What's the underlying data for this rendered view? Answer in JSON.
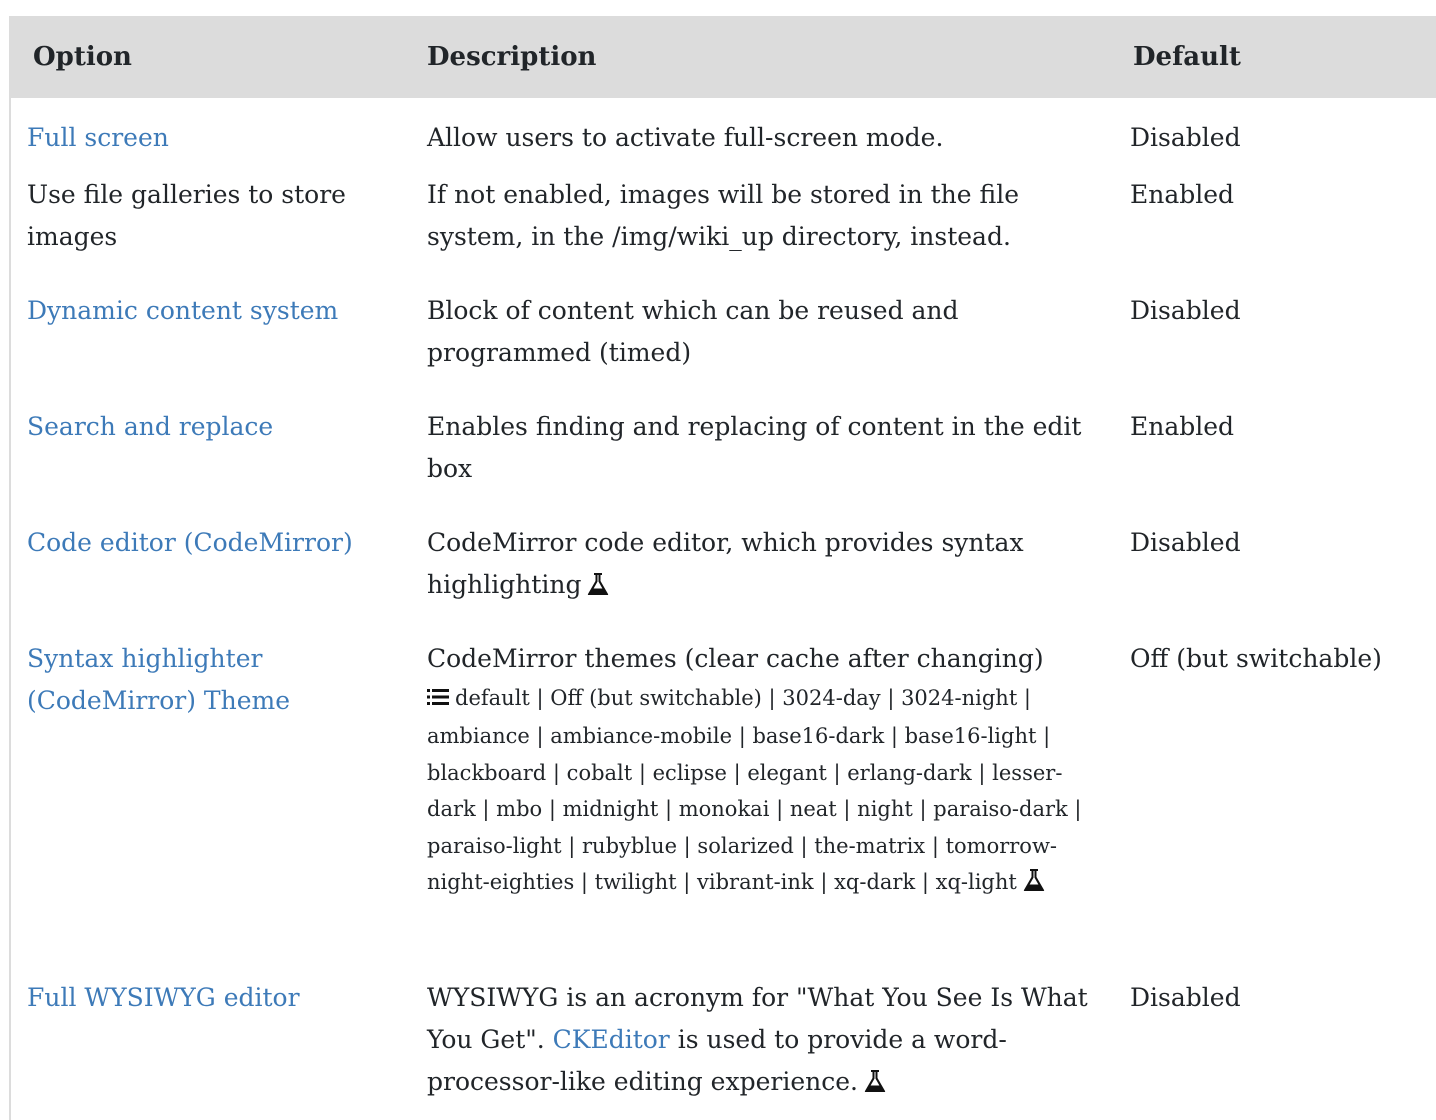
{
  "table": {
    "headers": {
      "option": "Option",
      "description": "Description",
      "default": "Default"
    },
    "rows": [
      {
        "option": "Full screen",
        "option_is_link": true,
        "description": "Allow users to activate full-screen mode.",
        "default": "Disabled"
      },
      {
        "option": "Use file galleries to store images",
        "option_is_link": false,
        "description": "If not enabled, images will be stored in the file system, in the /img/wiki_up directory, instead.",
        "default": "Enabled"
      },
      {
        "option": "Dynamic content system",
        "option_is_link": true,
        "description": "Block of content which can be reused and programmed (timed)",
        "default": "Disabled"
      },
      {
        "option": "Search and replace",
        "option_is_link": true,
        "description": "Enables finding and replacing of content in the edit box",
        "default": "Enabled"
      },
      {
        "option": "Code editor (CodeMirror)",
        "option_is_link": true,
        "description": "CodeMirror code editor, which provides syntax highlighting",
        "experimental_icon": "flask-icon",
        "default": "Disabled"
      },
      {
        "option": "Syntax highlighter (CodeMirror) Theme",
        "option_is_link": true,
        "description": "CodeMirror themes (clear cache after changing)",
        "options_icon": "list-icon",
        "options_text": "default | Off (but switchable) | 3024-day | 3024-night | ambiance | ambiance-mobile | base16-dark | base16-light | blackboard | cobalt | eclipse | elegant | erlang-dark | lesser-dark | mbo | midnight | monokai | neat | night | paraiso-dark | paraiso-light | rubyblue | solarized | the-matrix | tomorrow-night-eighties | twilight | vibrant-ink | xq-dark | xq-light",
        "experimental_icon": "flask-icon",
        "default": "Off (but switchable)"
      },
      {
        "option": "Full WYSIWYG editor",
        "option_is_link": true,
        "description_before": "WYSIWYG is an acronym for \"What You See Is What You Get\".",
        "description_link": "CKEditor",
        "description_after": "is used to provide a word-processor-like editing experience.",
        "experimental_icon": "flask-icon",
        "default": "Disabled"
      }
    ]
  },
  "colors": {
    "header_bg": "#dcdcdc",
    "link": "#3d7ab8",
    "text": "#212529"
  }
}
